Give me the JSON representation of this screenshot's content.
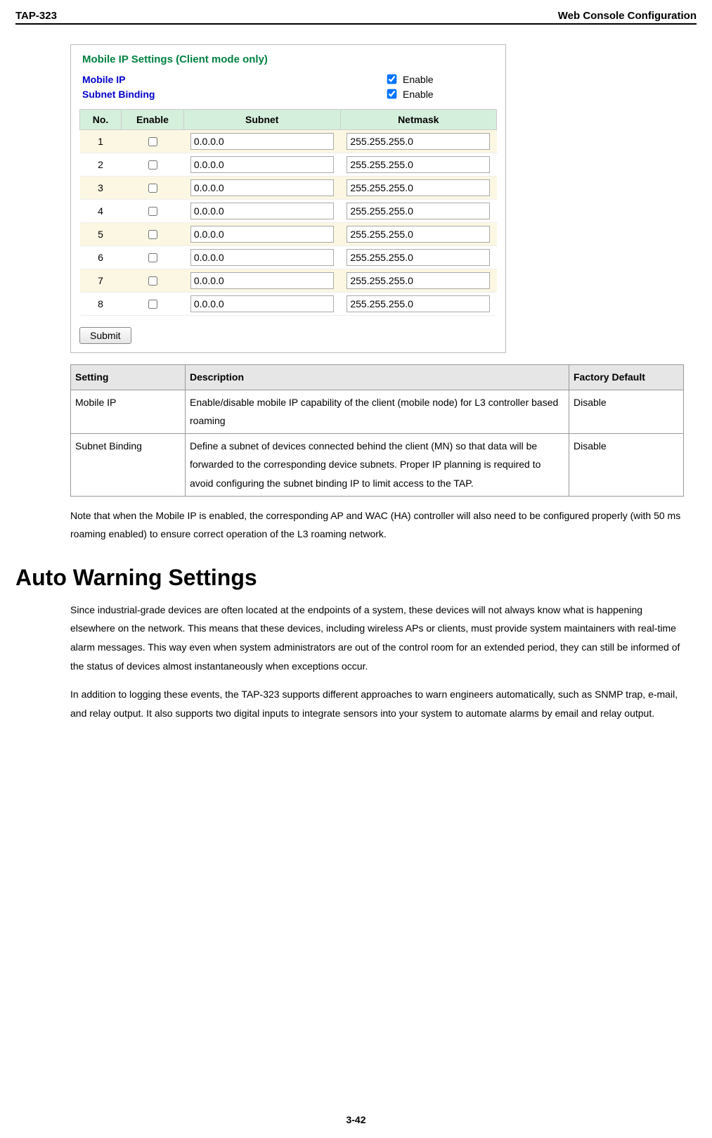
{
  "header": {
    "left": "TAP-323",
    "right": "Web Console Configuration"
  },
  "config": {
    "title": "Mobile IP Settings  (Client mode only)",
    "mobile_ip": {
      "label": "Mobile IP",
      "enable_text": "Enable",
      "checked": true
    },
    "subnet_binding": {
      "label": "Subnet Binding",
      "enable_text": "Enable",
      "checked": true
    },
    "columns": {
      "no": "No.",
      "enable": "Enable",
      "subnet": "Subnet",
      "netmask": "Netmask"
    },
    "rows": [
      {
        "no": "1",
        "enable": false,
        "subnet": "0.0.0.0",
        "netmask": "255.255.255.0"
      },
      {
        "no": "2",
        "enable": false,
        "subnet": "0.0.0.0",
        "netmask": "255.255.255.0"
      },
      {
        "no": "3",
        "enable": false,
        "subnet": "0.0.0.0",
        "netmask": "255.255.255.0"
      },
      {
        "no": "4",
        "enable": false,
        "subnet": "0.0.0.0",
        "netmask": "255.255.255.0"
      },
      {
        "no": "5",
        "enable": false,
        "subnet": "0.0.0.0",
        "netmask": "255.255.255.0"
      },
      {
        "no": "6",
        "enable": false,
        "subnet": "0.0.0.0",
        "netmask": "255.255.255.0"
      },
      {
        "no": "7",
        "enable": false,
        "subnet": "0.0.0.0",
        "netmask": "255.255.255.0"
      },
      {
        "no": "8",
        "enable": false,
        "subnet": "0.0.0.0",
        "netmask": "255.255.255.0"
      }
    ],
    "submit_label": "Submit"
  },
  "desc_table": {
    "head": {
      "setting": "Setting",
      "description": "Description",
      "default": "Factory Default"
    },
    "rows": [
      {
        "setting": "Mobile IP",
        "description": "Enable/disable mobile IP capability of the client (mobile node) for L3 controller based roaming",
        "default": "Disable"
      },
      {
        "setting": "Subnet Binding",
        "description": "Define a subnet of devices connected behind the client (MN) so that data will be forwarded to the corresponding device subnets. Proper IP planning is required to avoid configuring the subnet binding IP to limit access to the TAP.",
        "default": "Disable"
      }
    ]
  },
  "note": "Note that when the Mobile IP is enabled, the corresponding AP and WAC (HA) controller will also need to be configured properly (with 50 ms roaming enabled) to ensure correct operation of the L3 roaming network.",
  "section_heading": "Auto Warning Settings",
  "para1": "Since industrial-grade devices are often located at the endpoints of a system, these devices will not always know what is happening elsewhere on the network. This means that these devices, including wireless APs or clients, must provide system maintainers with real-time alarm messages. This way even when system administrators are out of the control room for an extended period, they can still be informed of the status of devices almost instantaneously when exceptions occur.",
  "para2": "In addition to logging these events, the TAP-323 supports different approaches to warn engineers automatically, such as SNMP trap, e-mail, and relay output. It also supports two digital inputs to integrate sensors into your system to automate alarms by email and relay output.",
  "page_num": "3-42"
}
